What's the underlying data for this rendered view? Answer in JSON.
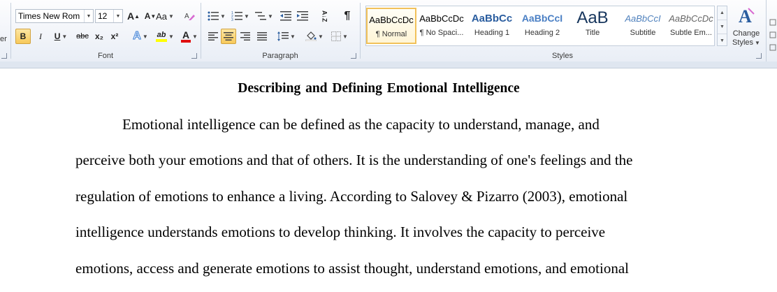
{
  "ribbon": {
    "clipboard_fragment": "er",
    "font": {
      "label": "Font",
      "font_name": "Times New Rom",
      "font_size": "12",
      "grow_label": "A",
      "shrink_label": "A",
      "change_case_label": "Aa",
      "bold_label": "B",
      "italic_label": "I",
      "underline_label": "U",
      "strike_label": "abc",
      "subscript_label": "x₂",
      "superscript_label": "x²",
      "text_effects_label": "A",
      "highlight_label": "ab",
      "font_color_label": "A"
    },
    "paragraph": {
      "label": "Paragraph",
      "pilcrow": "¶",
      "sort_label": "A↓Z"
    },
    "styles": {
      "label": "Styles",
      "items": [
        {
          "sample": "AaBbCcDc",
          "name": "¶ Normal"
        },
        {
          "sample": "AaBbCcDc",
          "name": "¶ No Spaci..."
        },
        {
          "sample": "AaBbCc",
          "name": "Heading 1"
        },
        {
          "sample": "AaBbCcI",
          "name": "Heading 2"
        },
        {
          "sample": "AaB",
          "name": "Title"
        },
        {
          "sample": "AaBbCcI",
          "name": "Subtitle"
        },
        {
          "sample": "AaBbCcDc",
          "name": "Subtle Em..."
        }
      ],
      "change_styles_line1": "Change",
      "change_styles_line2": "Styles"
    }
  },
  "document": {
    "title": "Describing and Defining Emotional Intelligence",
    "lines": [
      "Emotional intelligence can be defined as the capacity to understand, manage, and",
      "perceive both your emotions and that of others. It is the understanding of one's feelings and the",
      "regulation of emotions to enhance a living. According to Salovey & Pizarro (2003), emotional",
      "intelligence understands emotions to develop thinking. It involves the capacity to perceive",
      "emotions, access and generate emotions to assist thought, understand emotions, and emotional"
    ]
  },
  "colors": {
    "accent_highlight": "#f7c95a",
    "heading_blue": "#2a5d9f",
    "font_color_red": "#e01010",
    "highlight_yellow": "#ffff00"
  }
}
